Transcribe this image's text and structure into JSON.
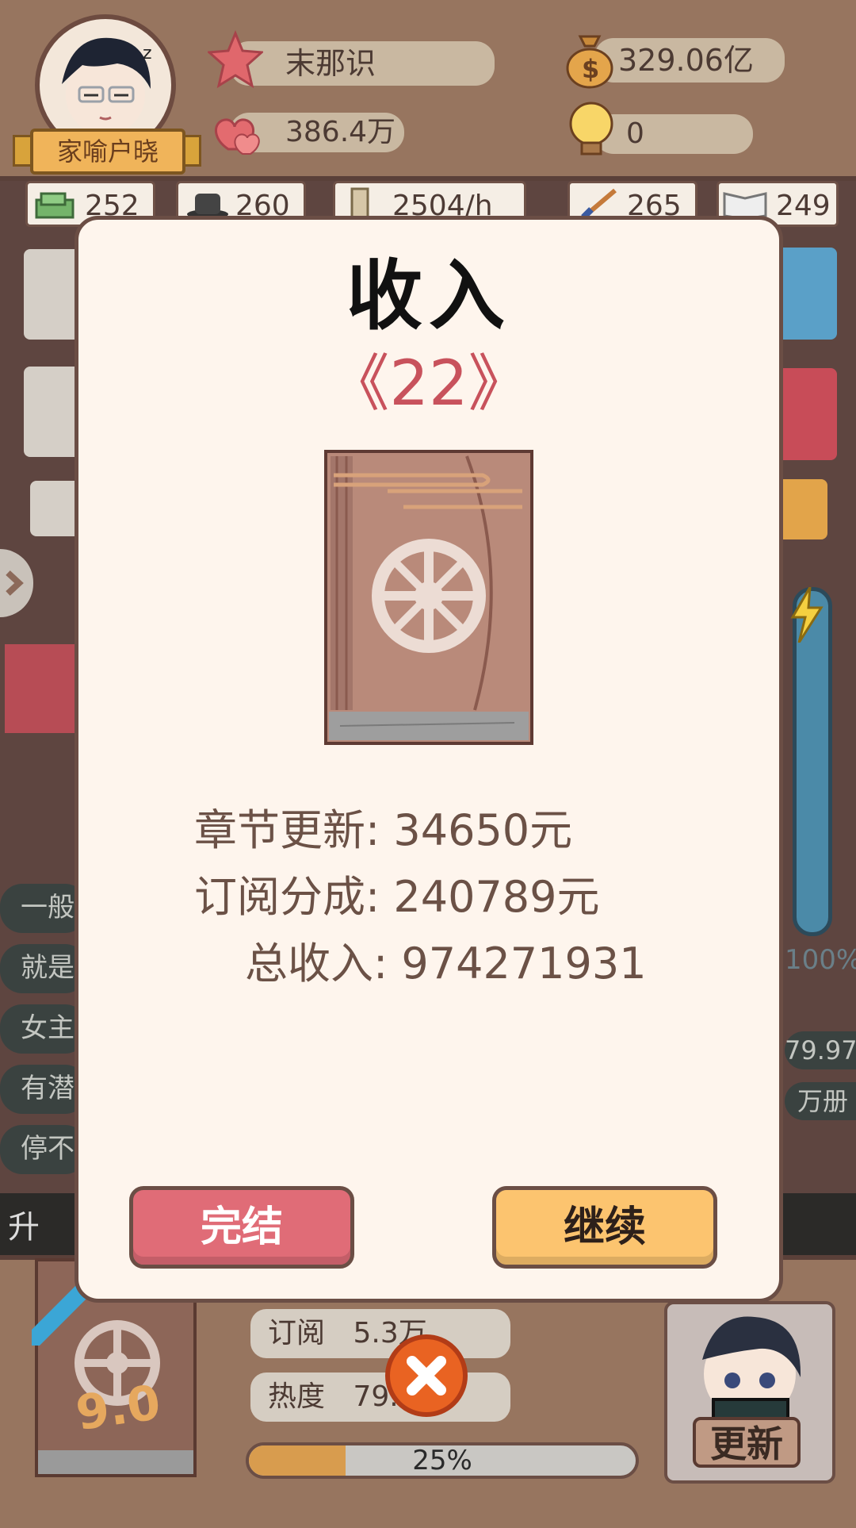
{
  "profile": {
    "name": "家喻户晓",
    "title": "末那识"
  },
  "stats": {
    "money": "329.06亿",
    "fans": "386.4万",
    "ideas": "0"
  },
  "resources": [
    "252",
    "260",
    "2504/h",
    "265",
    "249"
  ],
  "modal": {
    "title": "收入",
    "book_name": "《22》",
    "chapter_label": "章节更新:",
    "chapter_value": "34650元",
    "subscription_label": "订阅分成:",
    "subscription_value": "240789元",
    "total_label": "总收入:",
    "total_value": "974271931",
    "finish_button": "完结",
    "continue_button": "继续"
  },
  "bottom": {
    "subscription_label": "订阅",
    "subscription_value": "5.3万",
    "heat_label": "热度",
    "heat_value": "79.",
    "progress_text": "25%",
    "progress_value": 25,
    "rating": "9.0",
    "update_button": "更新"
  },
  "background_fragments": {
    "side_pct": "100%",
    "side_value": "79.97",
    "side_unit": "万册",
    "rows": [
      "一般",
      "就是",
      "女主",
      "有潜",
      "停不"
    ],
    "level_up": "升"
  }
}
